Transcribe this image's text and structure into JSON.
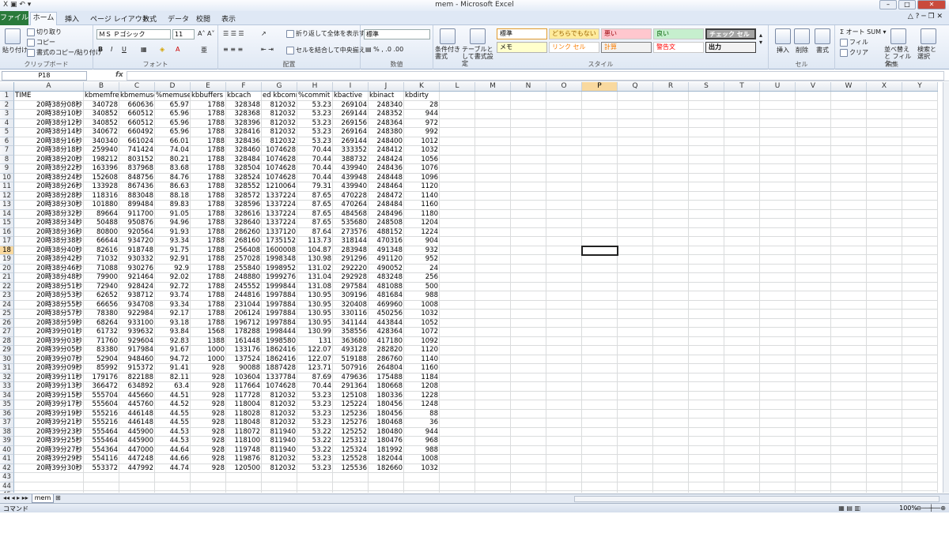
{
  "window": {
    "title": "mem - Microsoft Excel"
  },
  "tabs": [
    "ファイル",
    "ホーム",
    "挿入",
    "ページ レイアウト",
    "数式",
    "データ",
    "校閲",
    "表示"
  ],
  "ribbon": {
    "clipboard": {
      "paste": "貼り付け",
      "cut": "切り取り",
      "copy": "コピー",
      "format_painter": "書式のコピー/貼り付け",
      "label": "クリップボード"
    },
    "font": {
      "name": "ＭＳ Ｐゴシック",
      "size": "11",
      "label": "フォント"
    },
    "alignment": {
      "wrap": "折り返して全体を表示する",
      "merge": "セルを結合して中央揃え",
      "label": "配置"
    },
    "number": {
      "format": "標準",
      "label": "数値"
    },
    "styles": {
      "cond": "条件付き書式",
      "table": "テーブルとして書式設定",
      "items": [
        "標準",
        "どちらでもない",
        "悪い",
        "良い",
        "チェック セル",
        "メモ",
        "リンク セル",
        "計算",
        "警告文",
        "出力"
      ],
      "label": "スタイル"
    },
    "cells": {
      "insert": "挿入",
      "delete": "削除",
      "format": "書式",
      "label": "セル"
    },
    "editing": {
      "autosum": "オート SUM",
      "fill": "フィル",
      "clear": "クリア",
      "sort": "並べ替えと フィルター",
      "find": "検索と 選択",
      "label": "編集"
    }
  },
  "formula_bar": {
    "name_box": "P18",
    "fx": "fx",
    "value": ""
  },
  "columns": [
    "A",
    "B",
    "C",
    "D",
    "E",
    "F",
    "G",
    "H",
    "I",
    "J",
    "K",
    "L",
    "M",
    "N",
    "O",
    "P",
    "Q",
    "R",
    "S",
    "T",
    "U",
    "V",
    "W",
    "X",
    "Y"
  ],
  "selected_column": "P",
  "selected_row": 18,
  "header_row": [
    "TIME",
    "kbmemfree",
    "kbmemused",
    "%memused",
    "kbbuffers",
    "kbcached",
    "kbcommit",
    "%commit",
    "kbactive",
    "kbinact",
    "kbdirty"
  ],
  "header_display": [
    "TIME",
    "kbmemfree",
    "kbmemuse(",
    "%memused",
    "kbbuffers",
    "kbcach",
    "ed  kbcomr",
    "%commit",
    "kbactive",
    "kbinact",
    "kbdirty"
  ],
  "rows": [
    [
      "20時38分08秒",
      "340728",
      "660636",
      "65.97",
      "1788",
      "328348",
      "812032",
      "53.23",
      "269104",
      "248340",
      "28"
    ],
    [
      "20時38分10秒",
      "340852",
      "660512",
      "65.96",
      "1788",
      "328368",
      "812032",
      "53.23",
      "269144",
      "248352",
      "944"
    ],
    [
      "20時38分12秒",
      "340852",
      "660512",
      "65.96",
      "1788",
      "328396",
      "812032",
      "53.23",
      "269156",
      "248364",
      "972"
    ],
    [
      "20時38分14秒",
      "340672",
      "660492",
      "65.96",
      "1788",
      "328416",
      "812032",
      "53.23",
      "269164",
      "248380",
      "992"
    ],
    [
      "20時38分16秒",
      "340340",
      "661024",
      "66.01",
      "1788",
      "328436",
      "812032",
      "53.23",
      "269144",
      "248400",
      "1012"
    ],
    [
      "20時38分18秒",
      "259940",
      "741424",
      "74.04",
      "1788",
      "328460",
      "1074628",
      "70.44",
      "333352",
      "248412",
      "1032"
    ],
    [
      "20時38分20秒",
      "198212",
      "803152",
      "80.21",
      "1788",
      "328484",
      "1074628",
      "70.44",
      "388732",
      "248424",
      "1056"
    ],
    [
      "20時38分22秒",
      "163396",
      "837968",
      "83.68",
      "1788",
      "328504",
      "1074628",
      "70.44",
      "439940",
      "248436",
      "1076"
    ],
    [
      "20時38分24秒",
      "152608",
      "848756",
      "84.76",
      "1788",
      "328524",
      "1074628",
      "70.44",
      "439948",
      "248448",
      "1096"
    ],
    [
      "20時38分26秒",
      "133928",
      "867436",
      "86.63",
      "1788",
      "328552",
      "1210064",
      "79.31",
      "439940",
      "248464",
      "1120"
    ],
    [
      "20時38分28秒",
      "118316",
      "883048",
      "88.18",
      "1788",
      "328572",
      "1337224",
      "87.65",
      "470228",
      "248472",
      "1140"
    ],
    [
      "20時38分30秒",
      "101880",
      "899484",
      "89.83",
      "1788",
      "328596",
      "1337224",
      "87.65",
      "470264",
      "248484",
      "1160"
    ],
    [
      "20時38分32秒",
      "89664",
      "911700",
      "91.05",
      "1788",
      "328616",
      "1337224",
      "87.65",
      "484568",
      "248496",
      "1180"
    ],
    [
      "20時38分34秒",
      "50488",
      "950876",
      "94.96",
      "1788",
      "328640",
      "1337224",
      "87.65",
      "535680",
      "248508",
      "1204"
    ],
    [
      "20時38分36秒",
      "80800",
      "920564",
      "91.93",
      "1788",
      "286260",
      "1337120",
      "87.64",
      "273576",
      "488152",
      "1224"
    ],
    [
      "20時38分38秒",
      "66644",
      "934720",
      "93.34",
      "1788",
      "268160",
      "1735152",
      "113.73",
      "318144",
      "470316",
      "904"
    ],
    [
      "20時38分40秒",
      "82616",
      "918748",
      "91.75",
      "1788",
      "256408",
      "1600008",
      "104.87",
      "283948",
      "491348",
      "932"
    ],
    [
      "20時38分42秒",
      "71032",
      "930332",
      "92.91",
      "1788",
      "257028",
      "1998348",
      "130.98",
      "291296",
      "491120",
      "952"
    ],
    [
      "20時38分46秒",
      "71088",
      "930276",
      "92.9",
      "1788",
      "255840",
      "1998952",
      "131.02",
      "292220",
      "490052",
      "24"
    ],
    [
      "20時38分48秒",
      "79900",
      "921464",
      "92.02",
      "1788",
      "248880",
      "1999276",
      "131.04",
      "292928",
      "483248",
      "256"
    ],
    [
      "20時38分51秒",
      "72940",
      "928424",
      "92.72",
      "1788",
      "245552",
      "1999844",
      "131.08",
      "297584",
      "481088",
      "500"
    ],
    [
      "20時38分53秒",
      "62652",
      "938712",
      "93.74",
      "1788",
      "244816",
      "1997884",
      "130.95",
      "309196",
      "481684",
      "988"
    ],
    [
      "20時38分55秒",
      "66656",
      "934708",
      "93.34",
      "1788",
      "231044",
      "1997884",
      "130.95",
      "320408",
      "469960",
      "1008"
    ],
    [
      "20時38分57秒",
      "78380",
      "922984",
      "92.17",
      "1788",
      "206124",
      "1997884",
      "130.95",
      "330116",
      "450256",
      "1032"
    ],
    [
      "20時38分59秒",
      "68264",
      "933100",
      "93.18",
      "1788",
      "196712",
      "1997884",
      "130.95",
      "341144",
      "443844",
      "1052"
    ],
    [
      "20時39分01秒",
      "61732",
      "939632",
      "93.84",
      "1568",
      "178288",
      "1998444",
      "130.99",
      "358556",
      "428364",
      "1072"
    ],
    [
      "20時39分03秒",
      "71760",
      "929604",
      "92.83",
      "1388",
      "161448",
      "1998580",
      "131",
      "363680",
      "417180",
      "1092"
    ],
    [
      "20時39分05秒",
      "83380",
      "917984",
      "91.67",
      "1000",
      "133176",
      "1862416",
      "122.07",
      "493128",
      "282820",
      "1120"
    ],
    [
      "20時39分07秒",
      "52904",
      "948460",
      "94.72",
      "1000",
      "137524",
      "1862416",
      "122.07",
      "519188",
      "286760",
      "1140"
    ],
    [
      "20時39分09秒",
      "85992",
      "915372",
      "91.41",
      "928",
      "90088",
      "1887428",
      "123.71",
      "507916",
      "264804",
      "1160"
    ],
    [
      "20時39分11秒",
      "179176",
      "822188",
      "82.11",
      "928",
      "103604",
      "1337784",
      "87.69",
      "479636",
      "175488",
      "1184"
    ],
    [
      "20時39分13秒",
      "366472",
      "634892",
      "63.4",
      "928",
      "117664",
      "1074628",
      "70.44",
      "291364",
      "180668",
      "1208"
    ],
    [
      "20時39分15秒",
      "555704",
      "445660",
      "44.51",
      "928",
      "117728",
      "812032",
      "53.23",
      "125108",
      "180336",
      "1228"
    ],
    [
      "20時39分17秒",
      "555604",
      "445760",
      "44.52",
      "928",
      "118004",
      "812032",
      "53.23",
      "125224",
      "180456",
      "1248"
    ],
    [
      "20時39分19秒",
      "555216",
      "446148",
      "44.55",
      "928",
      "118028",
      "812032",
      "53.23",
      "125236",
      "180456",
      "88"
    ],
    [
      "20時39分21秒",
      "555216",
      "446148",
      "44.55",
      "928",
      "118048",
      "812032",
      "53.23",
      "125276",
      "180468",
      "36"
    ],
    [
      "20時39分23秒",
      "555464",
      "445900",
      "44.53",
      "928",
      "118072",
      "811940",
      "53.22",
      "125252",
      "180480",
      "944"
    ],
    [
      "20時39分25秒",
      "555464",
      "445900",
      "44.53",
      "928",
      "118100",
      "811940",
      "53.22",
      "125312",
      "180476",
      "968"
    ],
    [
      "20時39分27秒",
      "554364",
      "447000",
      "44.64",
      "928",
      "119748",
      "811940",
      "53.22",
      "125324",
      "181992",
      "988"
    ],
    [
      "20時39分29秒",
      "554116",
      "447248",
      "44.66",
      "928",
      "119876",
      "812032",
      "53.23",
      "125528",
      "182044",
      "1008"
    ],
    [
      "20時39分30秒",
      "553372",
      "447992",
      "44.74",
      "928",
      "120500",
      "812032",
      "53.23",
      "125536",
      "182660",
      "1032"
    ]
  ],
  "row_numbers_total": 45,
  "sheet_tab": "mem",
  "status": {
    "mode": "コマンド",
    "zoom": "100%"
  }
}
